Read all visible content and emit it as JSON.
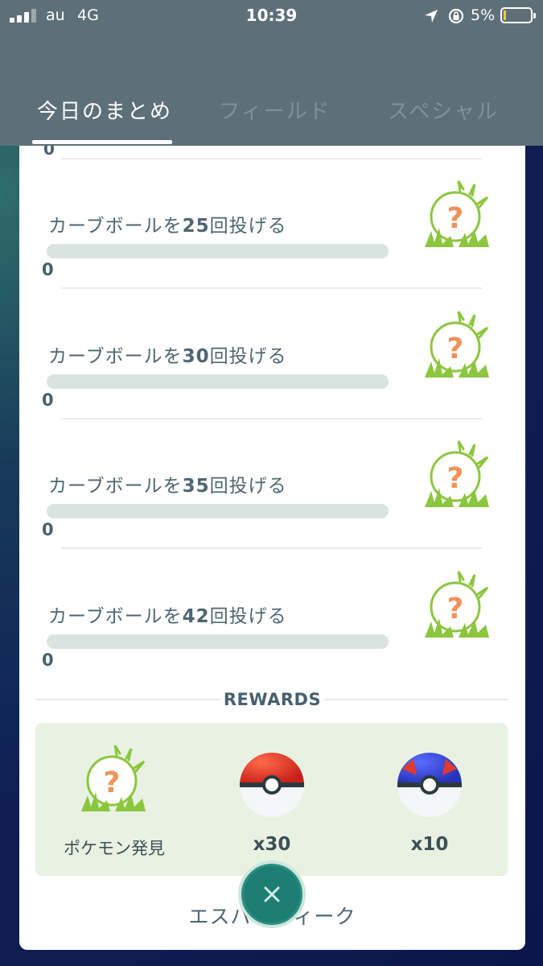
{
  "status_bar": {
    "carrier": "au",
    "network": "4G",
    "time": "10:39",
    "battery": "5%"
  },
  "tabs": [
    {
      "label": "今日のまとめ",
      "active": true
    },
    {
      "label": "フィールド",
      "active": false
    },
    {
      "label": "スペシャル",
      "active": false
    }
  ],
  "tasks": [
    {
      "title_prefix": "カーブボールを",
      "number": "25",
      "title_suffix": "回投げる",
      "progress": "0"
    },
    {
      "title_prefix": "カーブボールを",
      "number": "30",
      "title_suffix": "回投げる",
      "progress": "0"
    },
    {
      "title_prefix": "カーブボールを",
      "number": "35",
      "title_suffix": "回投げる",
      "progress": "0"
    },
    {
      "title_prefix": "カーブボールを",
      "number": "42",
      "title_suffix": "回投げる",
      "progress": "0"
    }
  ],
  "top_partial_count": "0",
  "rewards": {
    "title": "REWARDS",
    "items": [
      {
        "label": "ポケモン発見",
        "icon": "mystery-pokemon-icon"
      },
      {
        "label": "x30",
        "icon": "poke-ball-icon"
      },
      {
        "label": "x10",
        "icon": "great-ball-icon"
      }
    ]
  },
  "footer": {
    "name": "エスパーウィーク"
  },
  "colors": {
    "header": "#5d7079",
    "accent_green": "#1e7d74",
    "question_mark": "#f0935a",
    "grass": "#8cc63f"
  }
}
